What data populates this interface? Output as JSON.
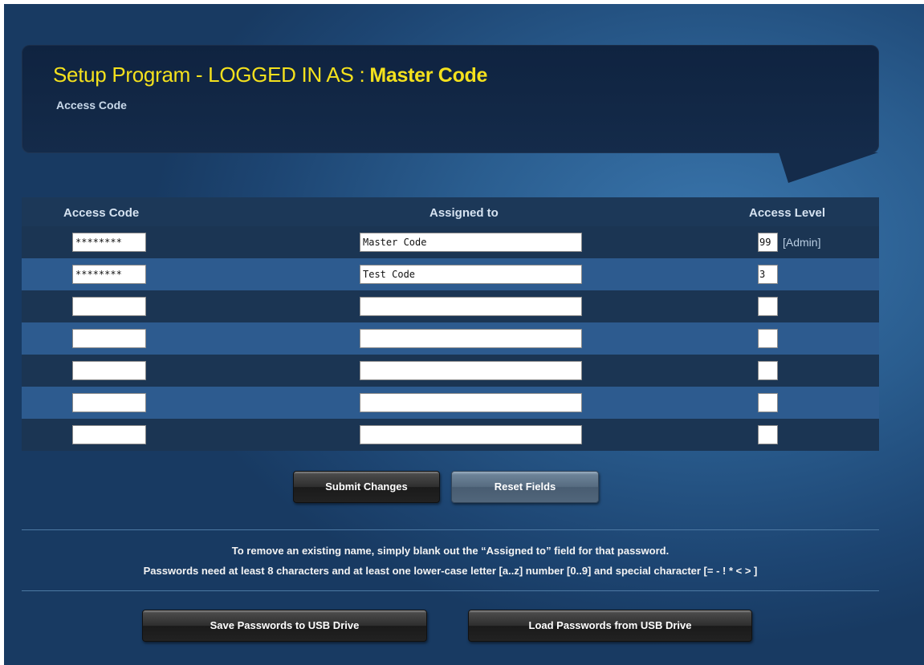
{
  "header": {
    "title_prefix": "Setup Program - LOGGED IN AS :",
    "logged_user": "Master Code",
    "subtitle": "Access Code"
  },
  "table": {
    "columns": [
      "Access Code",
      "Assigned to",
      "Access Level"
    ],
    "rows": [
      {
        "code": "********",
        "assigned": "Master Code",
        "level": "99",
        "level_note": "[Admin]"
      },
      {
        "code": "********",
        "assigned": "Test Code",
        "level": "3",
        "level_note": ""
      },
      {
        "code": "",
        "assigned": "",
        "level": "",
        "level_note": ""
      },
      {
        "code": "",
        "assigned": "",
        "level": "",
        "level_note": ""
      },
      {
        "code": "",
        "assigned": "",
        "level": "",
        "level_note": ""
      },
      {
        "code": "",
        "assigned": "",
        "level": "",
        "level_note": ""
      },
      {
        "code": "",
        "assigned": "",
        "level": "",
        "level_note": ""
      }
    ]
  },
  "buttons": {
    "submit": "Submit Changes",
    "reset": "Reset Fields",
    "save_usb": "Save Passwords to USB Drive",
    "load_usb": "Load Passwords from USB Drive"
  },
  "info": {
    "line1": "To remove an existing name, simply blank out the “Assigned to” field for that password.",
    "line2": "Passwords need at least 8 characters and at least one lower-case letter [a..z] number [0..9] and special character [= - ! * < > ]"
  },
  "colors": {
    "title": "#f4e11d",
    "background": "#2a5d8f",
    "header_panel": "#142b4a"
  }
}
